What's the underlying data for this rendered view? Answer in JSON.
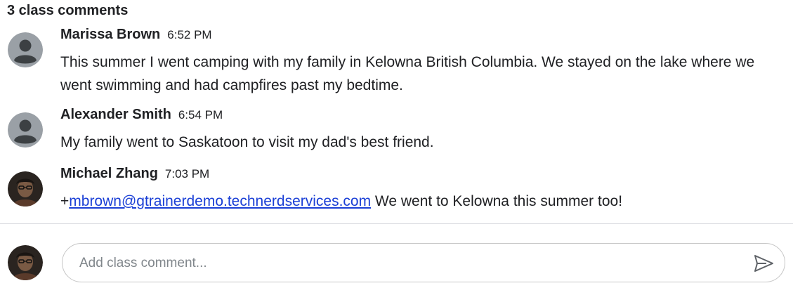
{
  "section": {
    "title": "3 class comments"
  },
  "comments": [
    {
      "author": "Marissa Brown",
      "time": "6:52 PM",
      "avatar": "default-person-icon",
      "text": "This summer I went camping with my family in Kelowna British Columbia. We stayed on the lake where we went swimming and had campfires past my bedtime."
    },
    {
      "author": "Alexander Smith",
      "time": "6:54 PM",
      "avatar": "default-person-icon",
      "text": "My family went to Saskatoon to visit my dad's best friend."
    },
    {
      "author": "Michael Zhang",
      "time": "7:03 PM",
      "avatar": "user-photo",
      "mention_prefix": "+",
      "mention": "mbrown@gtrainerdemo.technerdservices.com",
      "text": " We went to Kelowna this summer too!"
    }
  ],
  "composer": {
    "placeholder": "Add class comment...",
    "send_icon": "send-icon"
  },
  "colors": {
    "link": "#1a3fd6",
    "default_avatar_bg": "#9aa0a6",
    "divider": "#dadce0"
  }
}
